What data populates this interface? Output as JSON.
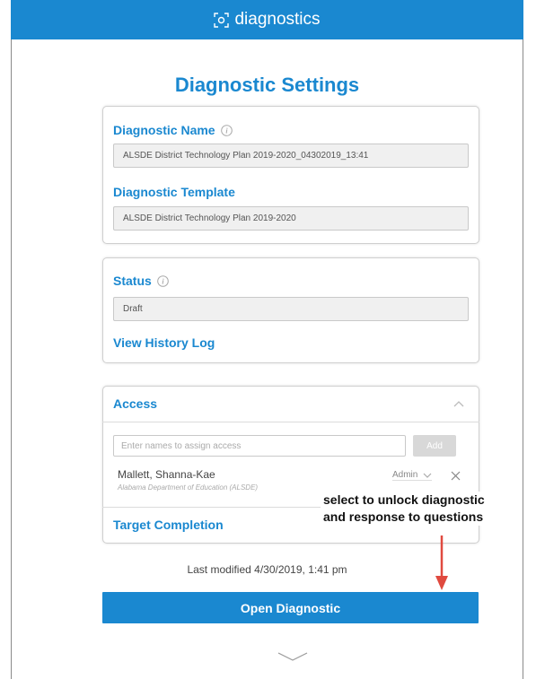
{
  "header": {
    "app_name": "diagnostics",
    "icon": "diagnostics-logo-icon"
  },
  "page_title": "Diagnostic Settings",
  "details": {
    "name_label": "Diagnostic Name",
    "name_value": "ALSDE District Technology Plan 2019-2020_04302019_13:41",
    "template_label": "Diagnostic Template",
    "template_value": "ALSDE District Technology Plan 2019-2020"
  },
  "status": {
    "label": "Status",
    "value": "Draft",
    "history_link": "View History Log"
  },
  "access": {
    "label": "Access",
    "input_placeholder": "Enter names to assign access",
    "add_label": "Add",
    "users": [
      {
        "name": "Mallett, Shanna-Kae",
        "org": "Alabama Department of Education (ALSDE)",
        "role": "Admin"
      }
    ],
    "target_completion_label": "Target Completion"
  },
  "annotation": {
    "line1": "select to unlock diagnostic",
    "line2": "and response to questions",
    "arrow_color": "#e04a3f"
  },
  "footer": {
    "last_modified": "Last modified 4/30/2019, 1:41 pm",
    "open_button": "Open Diagnostic"
  },
  "colors": {
    "accent": "#1a88d0"
  }
}
